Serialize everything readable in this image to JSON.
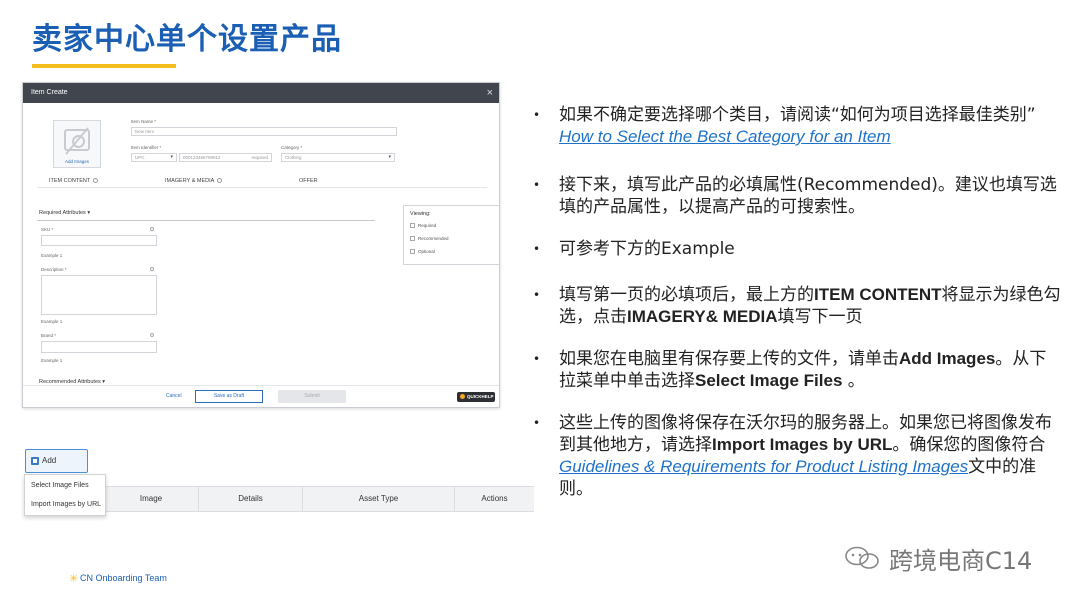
{
  "slide": {
    "title": "卖家中心单个设置产品",
    "footer": "CN Onboarding Team",
    "watermark": "跨境电商C14"
  },
  "item_create": {
    "window_title": "Item Create",
    "close": "×",
    "add_images": "Add Images",
    "item_name_label": "Item Name *",
    "item_name_value": "New Item",
    "item_identifier_label": "Item Identifier *",
    "identifier_type": "UPC",
    "identifier_value": "000123456789012",
    "identifier_hint": "required",
    "category_label": "Category *",
    "category_value": "Clothing",
    "steps": [
      "ITEM CONTENT",
      "IMAGERY & MEDIA",
      "OFFER"
    ],
    "required_attributes": "Required Attributes",
    "recommended_attributes": "Recommended Attributes",
    "fields": [
      {
        "label": "SKU *",
        "example": "Example 1"
      },
      {
        "label": "Description *",
        "example": "Example 1"
      },
      {
        "label": "Brand *",
        "example": "Example 1"
      }
    ],
    "viewing": {
      "title": "Viewing:",
      "items": [
        "Required",
        "Recommended",
        "Optional"
      ]
    },
    "footer": {
      "cancel": "Cancel",
      "save_draft": "Save as Draft",
      "submit": "Submit",
      "quickhelp": "QUICKHELP"
    }
  },
  "add_images_menu": {
    "button": "Add Images",
    "options": [
      "Select Image Files",
      "Import Images by URL"
    ],
    "columns": [
      "Image",
      "Details",
      "Asset Type",
      "Actions"
    ]
  },
  "bullets": {
    "b1_pre": "如果不确定要选择哪个类目，请阅读“如何为项目选择最佳类别”",
    "b1_link": "How to Select the Best Category for an Item",
    "b2": "接下来，填写此产品的必填属性(Recommended)。建议也填写选填的产品属性，以提高产品的可搜索性。",
    "b3": "可参考下方的Example",
    "b4_pre": "填写第一页的必填项后，最上方的",
    "b4_b1": "ITEM CONTENT",
    "b4_mid": "将显示为绿色勾选，点击",
    "b4_b2": "IMAGERY& MEDIA",
    "b4_post": "填写下一页",
    "b5_pre": "如果您在电脑里有保存要上传的文件，请单击",
    "b5_b1": "Add Images",
    "b5_mid": "。从下拉菜单中单击选择",
    "b5_b2": "Select Image Files",
    "b5_post": " 。",
    "b6_pre": "这些上传的图像将保存在沃尔玛的服务器上。如果您已将图像发布到其他地方，请选择",
    "b6_b1": "Import Images by URL",
    "b6_mid": "。确保您的图像符合",
    "b6_link": "Guidelines & Requirements for Product Listing Images",
    "b6_post": "文中的准则。"
  }
}
